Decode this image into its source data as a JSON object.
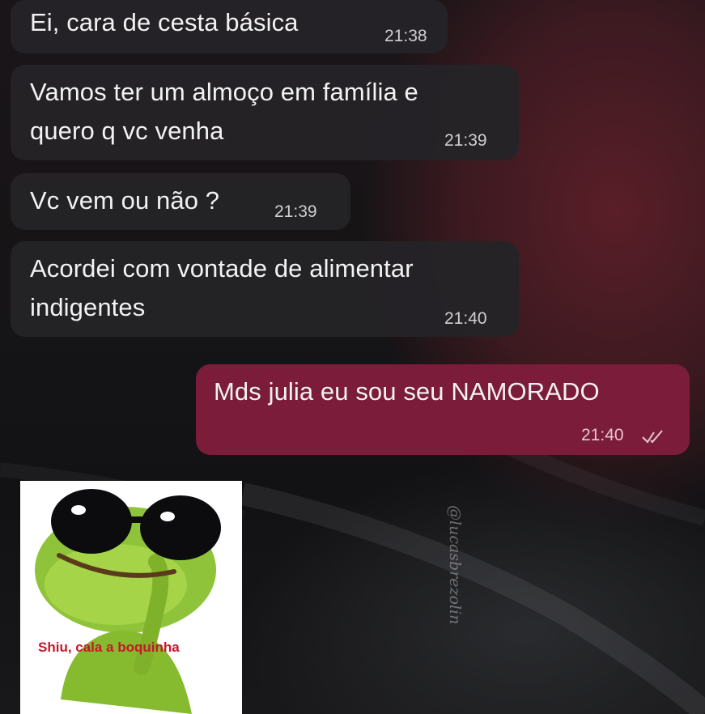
{
  "messages": [
    {
      "text": "Ei, cara de cesta básica",
      "time": "21:38",
      "direction": "incoming"
    },
    {
      "line1": "Vamos ter um almoço em família e",
      "line2": "quero q vc venha",
      "time": "21:39",
      "direction": "incoming"
    },
    {
      "text": "Vc vem ou não ?",
      "time": "21:39",
      "direction": "incoming"
    },
    {
      "line1": "Acordei com vontade de alimentar",
      "line2": "indigentes",
      "time": "21:40",
      "direction": "incoming"
    },
    {
      "text": "Mds julia eu sou seu NAMORADO",
      "time": "21:40",
      "direction": "outgoing",
      "status_icon": "double-check-icon"
    }
  ],
  "sticker": {
    "caption": "Shiu, cala a boquinha",
    "image": "frog-sunglasses-shush-sticker"
  },
  "watermark": "@lucasbrezolin",
  "colors": {
    "incoming_bubble": "#242326",
    "outgoing_bubble": "#7a1c3a",
    "text": "#f2f2f2",
    "caption": "#c8162a"
  }
}
